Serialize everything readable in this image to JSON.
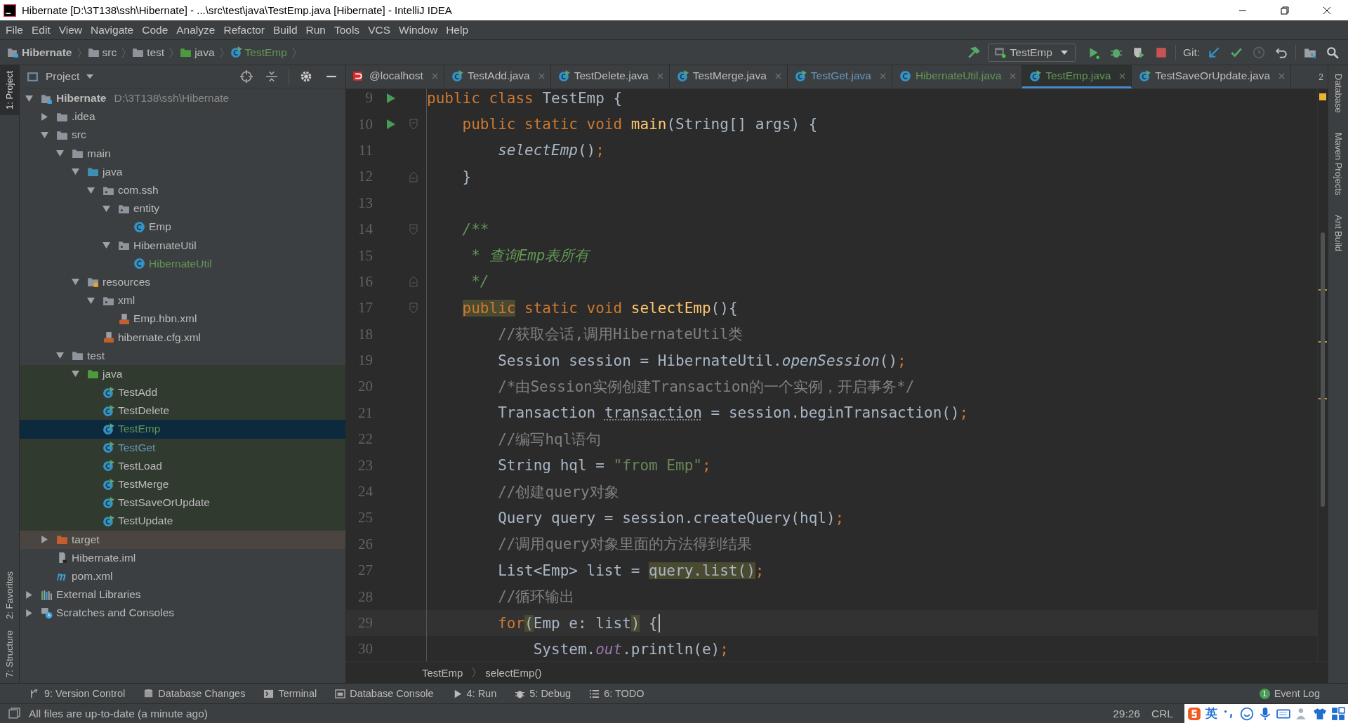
{
  "window": {
    "title": "Hibernate [D:\\3T138\\ssh\\Hibernate] - ...\\src\\test\\java\\TestEmp.java [Hibernate] - IntelliJ IDEA"
  },
  "menu": [
    "File",
    "Edit",
    "View",
    "Navigate",
    "Code",
    "Analyze",
    "Refactor",
    "Build",
    "Run",
    "Tools",
    "VCS",
    "Window",
    "Help"
  ],
  "nav_bar": {
    "crumbs": [
      {
        "label": "Hibernate",
        "kind": "module"
      },
      {
        "label": "src",
        "kind": "folder"
      },
      {
        "label": "test",
        "kind": "folder"
      },
      {
        "label": "java",
        "kind": "test-folder"
      },
      {
        "label": "TestEmp",
        "kind": "test-class",
        "color": "#629755"
      }
    ],
    "run_config": "TestEmp",
    "git_label": "Git:"
  },
  "left_stripe": [
    {
      "label": "1: Project",
      "selected": true
    },
    {
      "label": "2: Favorites",
      "selected": false
    },
    {
      "label": "7: Structure",
      "selected": false
    }
  ],
  "right_stripe": [
    {
      "label": "Database"
    },
    {
      "label": "Maven Projects"
    },
    {
      "label": "Ant Build"
    }
  ],
  "project": {
    "title": "Project",
    "tree": [
      {
        "label": "Hibernate",
        "path": "D:\\3T138\\ssh\\Hibernate",
        "kind": "module",
        "expanded": true,
        "selected": false,
        "children": [
          {
            "label": ".idea",
            "kind": "folder",
            "expanded": false,
            "selected": false
          },
          {
            "label": "src",
            "kind": "folder",
            "expanded": true,
            "selected": false,
            "children": [
              {
                "label": "main",
                "kind": "folder",
                "expanded": true,
                "selected": false,
                "children": [
                  {
                    "label": "java",
                    "kind": "source-folder",
                    "expanded": true,
                    "selected": false,
                    "children": [
                      {
                        "label": "com.ssh",
                        "kind": "package",
                        "expanded": true,
                        "selected": false,
                        "children": [
                          {
                            "label": "entity",
                            "kind": "package",
                            "expanded": true,
                            "selected": false,
                            "children": [
                              {
                                "label": "Emp",
                                "kind": "class",
                                "selected": false
                              }
                            ]
                          },
                          {
                            "label": "HibernateUtil",
                            "kind": "package",
                            "expanded": true,
                            "selected": false,
                            "children": [
                              {
                                "label": "HibernateUtil",
                                "kind": "class",
                                "color": "#629755",
                                "selected": false
                              }
                            ]
                          }
                        ]
                      }
                    ]
                  },
                  {
                    "label": "resources",
                    "kind": "resources-folder",
                    "expanded": true,
                    "selected": false,
                    "children": [
                      {
                        "label": "xml",
                        "kind": "package",
                        "expanded": true,
                        "selected": false,
                        "children": [
                          {
                            "label": "Emp.hbn.xml",
                            "kind": "xml",
                            "selected": false
                          }
                        ]
                      },
                      {
                        "label": "hibernate.cfg.xml",
                        "kind": "xml",
                        "selected": false
                      }
                    ]
                  }
                ]
              },
              {
                "label": "test",
                "kind": "folder",
                "expanded": true,
                "selected": false,
                "children": [
                  {
                    "label": "java",
                    "kind": "test-folder",
                    "expanded": true,
                    "test_scope": true,
                    "selected": false,
                    "children": [
                      {
                        "label": "TestAdd",
                        "kind": "test-class",
                        "test_scope": true,
                        "selected": false
                      },
                      {
                        "label": "TestDelete",
                        "kind": "test-class",
                        "test_scope": true,
                        "selected": false
                      },
                      {
                        "label": "TestEmp",
                        "kind": "test-class",
                        "test_scope": true,
                        "color": "#629755",
                        "selected": true
                      },
                      {
                        "label": "TestGet",
                        "kind": "test-class",
                        "test_scope": true,
                        "color": "#6897bb",
                        "selected": false
                      },
                      {
                        "label": "TestLoad",
                        "kind": "test-class",
                        "test_scope": true,
                        "selected": false
                      },
                      {
                        "label": "TestMerge",
                        "kind": "test-class",
                        "test_scope": true,
                        "selected": false
                      },
                      {
                        "label": "TestSaveOrUpdate",
                        "kind": "test-class",
                        "test_scope": true,
                        "selected": false
                      },
                      {
                        "label": "TestUpdate",
                        "kind": "test-class",
                        "test_scope": true,
                        "selected": false
                      }
                    ]
                  }
                ]
              }
            ]
          },
          {
            "label": "target",
            "kind": "excluded-folder",
            "expanded": false,
            "excluded": true,
            "selected": false
          },
          {
            "label": "Hibernate.iml",
            "kind": "iml",
            "selected": false
          },
          {
            "label": "pom.xml",
            "kind": "maven",
            "selected": false
          }
        ]
      },
      {
        "label": "External Libraries",
        "kind": "libraries",
        "expanded": false,
        "selected": false
      },
      {
        "label": "Scratches and Consoles",
        "kind": "scratches",
        "expanded": false,
        "selected": false
      }
    ]
  },
  "editor": {
    "tabs": [
      {
        "label": "@localhost",
        "kind": "database",
        "selected": false
      },
      {
        "label": "TestAdd.java",
        "kind": "test-class",
        "selected": false
      },
      {
        "label": "TestDelete.java",
        "kind": "test-class",
        "selected": false
      },
      {
        "label": "TestMerge.java",
        "kind": "test-class",
        "selected": false
      },
      {
        "label": "TestGet.java",
        "kind": "test-class",
        "color": "#6897bb",
        "selected": false
      },
      {
        "label": "HibernateUtil.java",
        "kind": "class",
        "color": "#629755",
        "selected": false
      },
      {
        "label": "TestEmp.java",
        "kind": "test-class",
        "color": "#629755",
        "selected": true
      },
      {
        "label": "TestSaveOrUpdate.java",
        "kind": "test-class",
        "selected": false
      }
    ],
    "hidden_tabs": "2",
    "lines": [
      {
        "number": "9",
        "run": true,
        "fold_start": false,
        "fold_end": false,
        "current": false,
        "tokens": [
          {
            "kind": "keyword",
            "text": "public class "
          },
          {
            "kind": "plain",
            "text": "TestEmp {"
          }
        ]
      },
      {
        "number": "10",
        "run": true,
        "fold_start": true,
        "fold_end": false,
        "current": false,
        "tokens": [
          {
            "kind": "keyword",
            "text": "    public static void "
          },
          {
            "kind": "declaration",
            "text": "main"
          },
          {
            "kind": "plain",
            "text": "(String[] args) {"
          }
        ]
      },
      {
        "number": "11",
        "run": false,
        "fold_start": false,
        "fold_end": false,
        "current": false,
        "tokens": [
          {
            "kind": "static-call",
            "text": "        selectEmp"
          },
          {
            "kind": "plain",
            "text": "()"
          },
          {
            "kind": "punct",
            "text": ";"
          }
        ]
      },
      {
        "number": "12",
        "run": false,
        "fold_start": false,
        "fold_end": true,
        "current": false,
        "tokens": [
          {
            "kind": "plain",
            "text": "    }"
          }
        ]
      },
      {
        "number": "13",
        "run": false,
        "fold_start": false,
        "fold_end": false,
        "current": false
      },
      {
        "number": "14",
        "run": false,
        "fold_start": true,
        "fold_end": false,
        "current": false,
        "tokens": [
          {
            "kind": "doc",
            "text": "    /**"
          }
        ]
      },
      {
        "number": "15",
        "run": false,
        "fold_start": false,
        "fold_end": false,
        "current": false,
        "tokens": [
          {
            "kind": "doc",
            "text": "     * 查询Emp表所有"
          }
        ]
      },
      {
        "number": "16",
        "run": false,
        "fold_start": false,
        "fold_end": true,
        "current": false,
        "tokens": [
          {
            "kind": "doc",
            "text": "     */"
          }
        ]
      },
      {
        "number": "17",
        "run": false,
        "fold_start": true,
        "fold_end": false,
        "current": false,
        "tokens": [
          {
            "kind": "keyword",
            "text": "    public",
            "highlight": true
          },
          {
            "kind": "keyword",
            "text": " static void "
          },
          {
            "kind": "declaration",
            "text": "selectEmp"
          },
          {
            "kind": "plain",
            "text": "(){"
          }
        ]
      },
      {
        "number": "18",
        "run": false,
        "fold_start": false,
        "fold_end": false,
        "current": false,
        "tokens": [
          {
            "kind": "comment",
            "text": "        //获取会话,调用HibernateUtil类"
          }
        ]
      },
      {
        "number": "19",
        "run": false,
        "fold_start": false,
        "fold_end": false,
        "current": false,
        "tokens": [
          {
            "kind": "plain",
            "text": "        Session session = HibernateUtil."
          },
          {
            "kind": "static-call",
            "text": "openSession"
          },
          {
            "kind": "plain",
            "text": "()"
          },
          {
            "kind": "punct",
            "text": ";"
          }
        ]
      },
      {
        "number": "20",
        "run": false,
        "fold_start": false,
        "fold_end": false,
        "current": false,
        "tokens": [
          {
            "kind": "comment",
            "text": "        /*由Session实例创建Transaction的一个实例，开启事务*/"
          }
        ]
      },
      {
        "number": "21",
        "run": false,
        "fold_start": false,
        "fold_end": false,
        "current": false,
        "tokens": [
          {
            "kind": "plain",
            "text": "        Transaction "
          },
          {
            "kind": "unused",
            "text": "transaction"
          },
          {
            "kind": "plain",
            "text": " = session.beginTransaction()"
          },
          {
            "kind": "punct",
            "text": ";"
          }
        ]
      },
      {
        "number": "22",
        "run": false,
        "fold_start": false,
        "fold_end": false,
        "current": false,
        "tokens": [
          {
            "kind": "comment",
            "text": "        //编写hql语句"
          }
        ]
      },
      {
        "number": "23",
        "run": false,
        "fold_start": false,
        "fold_end": false,
        "current": false,
        "tokens": [
          {
            "kind": "plain",
            "text": "        String hql = "
          },
          {
            "kind": "string",
            "text": "\"from Emp\""
          },
          {
            "kind": "punct",
            "text": ";"
          }
        ]
      },
      {
        "number": "24",
        "run": false,
        "fold_start": false,
        "fold_end": false,
        "current": false,
        "tokens": [
          {
            "kind": "comment",
            "text": "        //创建query对象"
          }
        ]
      },
      {
        "number": "25",
        "run": false,
        "fold_start": false,
        "fold_end": false,
        "current": false,
        "tokens": [
          {
            "kind": "plain",
            "text": "        Query query = session.createQuery(hql)"
          },
          {
            "kind": "punct",
            "text": ";"
          }
        ]
      },
      {
        "number": "26",
        "run": false,
        "fold_start": false,
        "fold_end": false,
        "current": false,
        "tokens": [
          {
            "kind": "comment",
            "text": "        //调用query对象里面的方法得到结果"
          }
        ]
      },
      {
        "number": "27",
        "run": false,
        "fold_start": false,
        "fold_end": false,
        "current": false,
        "tokens": [
          {
            "kind": "plain",
            "text": "        List<Emp> list = "
          },
          {
            "kind": "plain",
            "text": "query.list()",
            "highlight": true
          },
          {
            "kind": "punct",
            "text": ";"
          }
        ]
      },
      {
        "number": "28",
        "run": false,
        "fold_start": false,
        "fold_end": false,
        "current": false,
        "tokens": [
          {
            "kind": "comment",
            "text": "        //循环输出"
          }
        ]
      },
      {
        "number": "29",
        "run": false,
        "fold_start": false,
        "fold_end": false,
        "current": true,
        "tokens": [
          {
            "kind": "keyword",
            "text": "        for"
          },
          {
            "kind": "plain",
            "text": "(",
            "highlight": true
          },
          {
            "kind": "plain",
            "text": "Emp e: list"
          },
          {
            "kind": "plain",
            "text": ")",
            "highlight": true
          },
          {
            "kind": "plain",
            "text": " {"
          }
        ]
      },
      {
        "number": "30",
        "run": false,
        "fold_start": false,
        "fold_end": false,
        "current": false,
        "tokens": [
          {
            "kind": "plain",
            "text": "            System."
          },
          {
            "kind": "static-field",
            "text": "out"
          },
          {
            "kind": "plain",
            "text": ".println(e)"
          },
          {
            "kind": "punct",
            "text": ";"
          }
        ]
      }
    ],
    "breadcrumbs": [
      "TestEmp",
      "selectEmp()"
    ]
  },
  "tool_windows": [
    {
      "label": "9: Version Control",
      "kind": "vcs"
    },
    {
      "label": "Database Changes",
      "kind": "database-changes"
    },
    {
      "label": "Terminal",
      "kind": "terminal"
    },
    {
      "label": "Database Console",
      "kind": "console"
    },
    {
      "label": "4: Run",
      "kind": "run"
    },
    {
      "label": "5: Debug",
      "kind": "debug"
    },
    {
      "label": "6: TODO",
      "kind": "todo"
    }
  ],
  "event_log": {
    "label": "Event Log",
    "count": "1"
  },
  "status_bar": {
    "message": "All files are up-to-date (a minute ago)",
    "position": "29:26",
    "line_separator": "CRL"
  },
  "ime_toolbar": {
    "mode": "英"
  }
}
